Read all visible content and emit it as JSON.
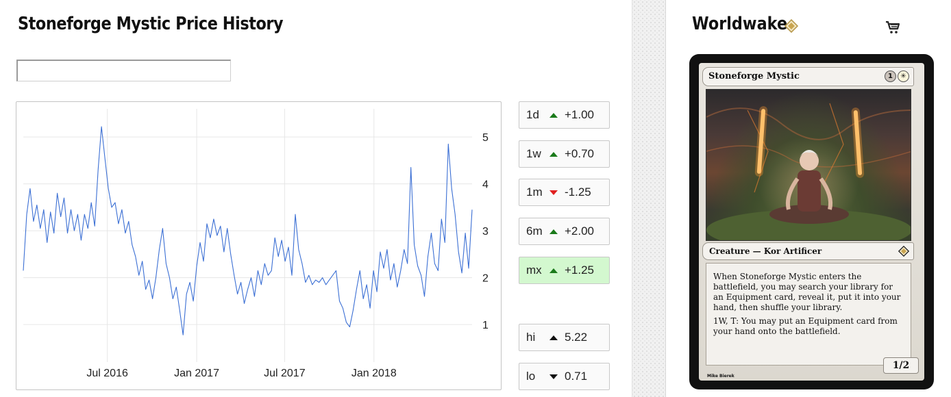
{
  "page": {
    "title": "Stoneforge Mystic Price History",
    "filter": {
      "value": "",
      "placeholder": ""
    }
  },
  "stats": {
    "changes": [
      {
        "label": "1d",
        "direction": "up",
        "value": "+1.00",
        "active": false
      },
      {
        "label": "1w",
        "direction": "up",
        "value": "+0.70",
        "active": false
      },
      {
        "label": "1m",
        "direction": "down",
        "value": "-1.25",
        "active": false
      },
      {
        "label": "6m",
        "direction": "up",
        "value": "+2.00",
        "active": false
      },
      {
        "label": "mx",
        "direction": "up",
        "value": "+1.25",
        "active": true
      }
    ],
    "hi": {
      "label": "hi",
      "value": "5.22"
    },
    "lo": {
      "label": "lo",
      "value": "0.71"
    }
  },
  "colors": {
    "line": "#3b6fd4",
    "grid": "#e6e6e6",
    "up": "#1a7a1a",
    "down": "#e02020",
    "active_bg": "#d3f8cf"
  },
  "chart_data": {
    "type": "line",
    "title": "",
    "xlabel": "",
    "ylabel": "",
    "x_ticks": [
      "Jul 2016",
      "Jan 2017",
      "Jul 2017",
      "Jan 2018"
    ],
    "y_ticks": [
      1,
      2,
      3,
      4,
      5
    ],
    "ylim": [
      0.2,
      5.6
    ],
    "xlim": [
      "2016-01-10",
      "2018-07-22"
    ],
    "grid": true,
    "legend": "none",
    "series": [
      {
        "name": "",
        "points": [
          [
            "2016-01-10",
            2.15
          ],
          [
            "2016-01-17",
            3.35
          ],
          [
            "2016-01-24",
            3.9
          ],
          [
            "2016-01-31",
            3.2
          ],
          [
            "2016-02-07",
            3.55
          ],
          [
            "2016-02-14",
            3.05
          ],
          [
            "2016-02-21",
            3.45
          ],
          [
            "2016-02-28",
            2.75
          ],
          [
            "2016-03-06",
            3.4
          ],
          [
            "2016-03-13",
            2.95
          ],
          [
            "2016-03-20",
            3.8
          ],
          [
            "2016-03-27",
            3.3
          ],
          [
            "2016-04-03",
            3.7
          ],
          [
            "2016-04-10",
            2.95
          ],
          [
            "2016-04-17",
            3.45
          ],
          [
            "2016-04-24",
            3.0
          ],
          [
            "2016-05-01",
            3.35
          ],
          [
            "2016-05-08",
            2.8
          ],
          [
            "2016-05-15",
            3.35
          ],
          [
            "2016-05-22",
            3.05
          ],
          [
            "2016-05-29",
            3.6
          ],
          [
            "2016-06-05",
            3.1
          ],
          [
            "2016-06-12",
            4.3
          ],
          [
            "2016-06-19",
            5.22
          ],
          [
            "2016-06-26",
            4.55
          ],
          [
            "2016-07-03",
            3.9
          ],
          [
            "2016-07-10",
            3.5
          ],
          [
            "2016-07-17",
            3.6
          ],
          [
            "2016-07-24",
            3.15
          ],
          [
            "2016-07-31",
            3.45
          ],
          [
            "2016-08-07",
            2.95
          ],
          [
            "2016-08-14",
            3.2
          ],
          [
            "2016-08-21",
            2.7
          ],
          [
            "2016-08-28",
            2.45
          ],
          [
            "2016-09-04",
            2.05
          ],
          [
            "2016-09-11",
            2.35
          ],
          [
            "2016-09-18",
            1.75
          ],
          [
            "2016-09-25",
            1.95
          ],
          [
            "2016-10-02",
            1.55
          ],
          [
            "2016-10-09",
            2.0
          ],
          [
            "2016-10-16",
            2.6
          ],
          [
            "2016-10-23",
            3.05
          ],
          [
            "2016-10-30",
            2.3
          ],
          [
            "2016-11-06",
            2.0
          ],
          [
            "2016-11-13",
            1.55
          ],
          [
            "2016-11-20",
            1.8
          ],
          [
            "2016-11-27",
            1.3
          ],
          [
            "2016-12-04",
            0.78
          ],
          [
            "2016-12-11",
            1.65
          ],
          [
            "2016-12-18",
            1.9
          ],
          [
            "2016-12-25",
            1.5
          ],
          [
            "2017-01-01",
            2.25
          ],
          [
            "2017-01-08",
            2.75
          ],
          [
            "2017-01-15",
            2.35
          ],
          [
            "2017-01-22",
            3.15
          ],
          [
            "2017-01-29",
            2.85
          ],
          [
            "2017-02-05",
            3.25
          ],
          [
            "2017-02-12",
            2.9
          ],
          [
            "2017-02-19",
            3.1
          ],
          [
            "2017-02-26",
            2.55
          ],
          [
            "2017-03-05",
            3.05
          ],
          [
            "2017-03-12",
            2.5
          ],
          [
            "2017-03-19",
            2.05
          ],
          [
            "2017-03-26",
            1.65
          ],
          [
            "2017-04-02",
            1.9
          ],
          [
            "2017-04-09",
            1.45
          ],
          [
            "2017-04-16",
            1.75
          ],
          [
            "2017-04-23",
            2.0
          ],
          [
            "2017-04-30",
            1.6
          ],
          [
            "2017-05-07",
            2.15
          ],
          [
            "2017-05-14",
            1.85
          ],
          [
            "2017-05-21",
            2.3
          ],
          [
            "2017-05-28",
            2.05
          ],
          [
            "2017-06-04",
            2.15
          ],
          [
            "2017-06-11",
            2.85
          ],
          [
            "2017-06-18",
            2.45
          ],
          [
            "2017-06-25",
            2.8
          ],
          [
            "2017-07-02",
            2.35
          ],
          [
            "2017-07-09",
            2.65
          ],
          [
            "2017-07-16",
            2.05
          ],
          [
            "2017-07-23",
            3.35
          ],
          [
            "2017-07-30",
            2.6
          ],
          [
            "2017-08-06",
            2.3
          ],
          [
            "2017-08-13",
            1.9
          ],
          [
            "2017-08-20",
            2.05
          ],
          [
            "2017-08-27",
            1.85
          ],
          [
            "2017-09-03",
            1.95
          ],
          [
            "2017-09-10",
            1.9
          ],
          [
            "2017-09-17",
            2.0
          ],
          [
            "2017-09-24",
            1.85
          ],
          [
            "2017-10-01",
            1.95
          ],
          [
            "2017-10-08",
            2.05
          ],
          [
            "2017-10-15",
            2.15
          ],
          [
            "2017-10-22",
            1.5
          ],
          [
            "2017-10-29",
            1.35
          ],
          [
            "2017-11-05",
            1.05
          ],
          [
            "2017-11-12",
            0.95
          ],
          [
            "2017-11-19",
            1.3
          ],
          [
            "2017-11-26",
            1.75
          ],
          [
            "2017-12-03",
            2.15
          ],
          [
            "2017-12-10",
            1.55
          ],
          [
            "2017-12-17",
            1.85
          ],
          [
            "2017-12-24",
            1.35
          ],
          [
            "2017-12-31",
            2.15
          ],
          [
            "2018-01-07",
            1.7
          ],
          [
            "2018-01-14",
            2.55
          ],
          [
            "2018-01-21",
            2.2
          ],
          [
            "2018-01-28",
            2.6
          ],
          [
            "2018-02-04",
            1.95
          ],
          [
            "2018-02-11",
            2.3
          ],
          [
            "2018-02-18",
            1.8
          ],
          [
            "2018-02-25",
            2.15
          ],
          [
            "2018-03-04",
            2.6
          ],
          [
            "2018-03-11",
            2.3
          ],
          [
            "2018-03-18",
            4.35
          ],
          [
            "2018-03-25",
            2.7
          ],
          [
            "2018-04-01",
            2.25
          ],
          [
            "2018-04-08",
            2.05
          ],
          [
            "2018-04-15",
            1.6
          ],
          [
            "2018-04-22",
            2.45
          ],
          [
            "2018-04-29",
            2.95
          ],
          [
            "2018-05-06",
            2.3
          ],
          [
            "2018-05-13",
            2.15
          ],
          [
            "2018-05-20",
            3.25
          ],
          [
            "2018-05-27",
            2.75
          ],
          [
            "2018-06-03",
            4.85
          ],
          [
            "2018-06-10",
            3.9
          ],
          [
            "2018-06-17",
            3.35
          ],
          [
            "2018-06-24",
            2.55
          ],
          [
            "2018-07-01",
            2.1
          ],
          [
            "2018-07-08",
            2.95
          ],
          [
            "2018-07-15",
            2.2
          ],
          [
            "2018-07-22",
            3.45
          ]
        ]
      }
    ]
  },
  "card_panel": {
    "set_name": "Worldwake",
    "set_icon": "worldwake-set-symbol-icon",
    "cart_icon": "shopping-cart-icon",
    "card": {
      "name": "Stoneforge Mystic",
      "mana": [
        "1",
        "W"
      ],
      "type_line": "Creature — Kor Artificer",
      "rules": [
        "When Stoneforge Mystic enters the battlefield, you may search your library for an Equipment card, reveal it, put it into your hand, then shuffle your library.",
        "1W, T: You may put an Equipment card from your hand onto the battlefield."
      ],
      "artist": "Mike Bierek",
      "pt": "1/2"
    }
  }
}
